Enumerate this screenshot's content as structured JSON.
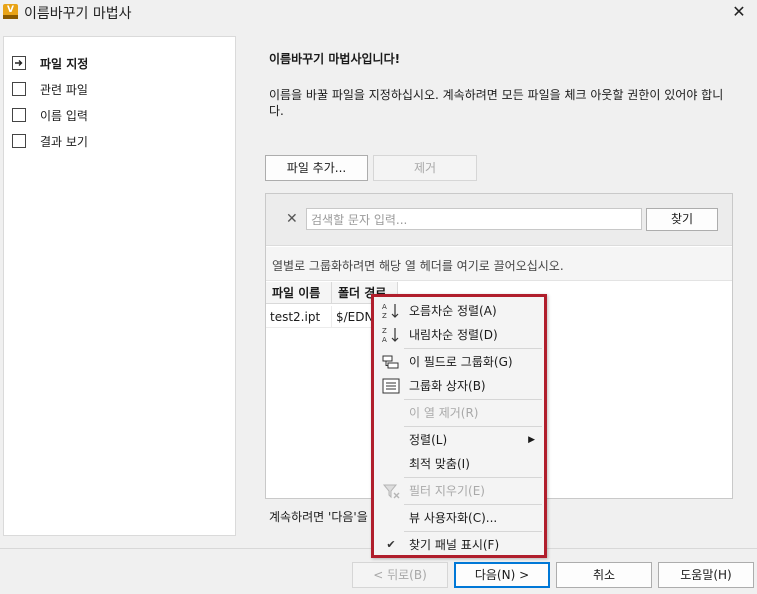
{
  "window": {
    "title": "이름바꾸기 마법사",
    "close_glyph": "✕"
  },
  "steps": [
    {
      "label": "파일 지정",
      "active": true
    },
    {
      "label": "관련 파일",
      "active": false
    },
    {
      "label": "이름 입력",
      "active": false
    },
    {
      "label": "결과 보기",
      "active": false
    }
  ],
  "main": {
    "heading": "이름바꾸기 마법사입니다!",
    "description": "이름을 바꿀 파일을 지정하십시오. 계속하려면 모든 파일을 체크 아웃할 권한이 있어야 합니다.",
    "add_file_label": "파일 추가...",
    "remove_label": "제거",
    "search_placeholder": "검색할 문자 입력...",
    "find_label": "찾기",
    "group_hint": "열별로 그룹화하려면 해당 열 헤더를 여기로 끌어오십시오.",
    "columns": [
      "파일 이름",
      "폴더 경로"
    ],
    "rows": [
      [
        "test2.ipt",
        "$/EDN"
      ]
    ],
    "footer_note": "계속하려면 '다음'을"
  },
  "buttons": {
    "back": "< 뒤로(B)",
    "next": "다음(N) >",
    "cancel": "취소",
    "help": "도움말(H)"
  },
  "context_menu": {
    "items": [
      {
        "label": "오름차순 정렬(A)",
        "icon": "sort-ascending-icon",
        "disabled": false
      },
      {
        "label": "내림차순 정렬(D)",
        "icon": "sort-descending-icon",
        "disabled": false
      },
      {
        "label": "이 필드로 그룹화(G)",
        "icon": "group-by-field-icon",
        "disabled": false
      },
      {
        "label": "그룹화 상자(B)",
        "icon": "group-box-icon",
        "disabled": false
      },
      {
        "label": "이 열 제거(R)",
        "icon": "",
        "disabled": true
      },
      {
        "label": "정렬(L)",
        "icon": "",
        "disabled": false,
        "submenu": true
      },
      {
        "label": "최적 맞춤(I)",
        "icon": "",
        "disabled": false
      },
      {
        "label": "필터 지우기(E)",
        "icon": "clear-filter-icon",
        "disabled": true
      },
      {
        "label": "뷰 사용자화(C)...",
        "icon": "",
        "disabled": false
      },
      {
        "label": "찾기 패널 표시(F)",
        "icon": "checkmark-icon",
        "disabled": false
      }
    ]
  },
  "colors": {
    "menu_highlight_border": "#b01e2c",
    "app_icon": "#e8a317",
    "focus_border": "#0078d7"
  }
}
